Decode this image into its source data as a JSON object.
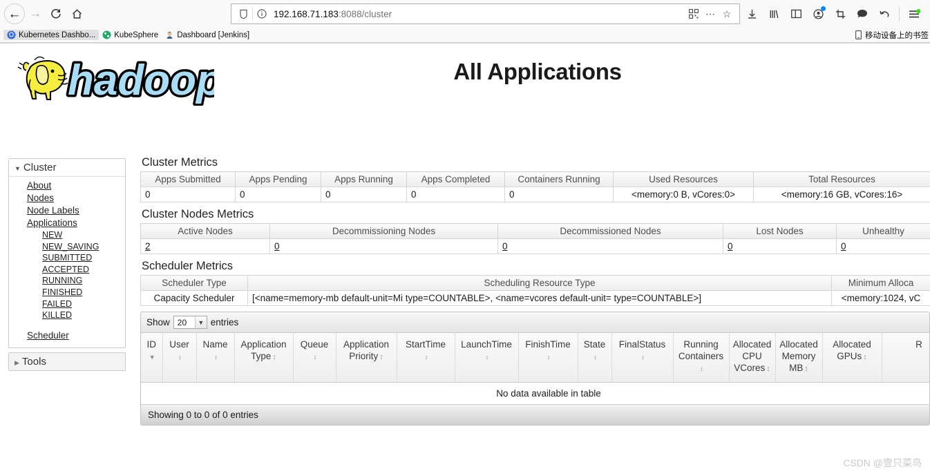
{
  "browser": {
    "nav": {
      "back_icon": "arrow-left-icon",
      "forward_icon": "arrow-right-icon",
      "reload_icon": "reload-icon",
      "home_icon": "home-icon"
    },
    "urlbar": {
      "shield_icon": "shield-icon",
      "info_icon": "info-circle-icon",
      "url_host": "192.168.71.183",
      "url_port_path": ":8088/cluster",
      "qr_icon": "qr-code-icon",
      "more_icon": "ellipsis-icon",
      "bookmark_icon": "star-icon"
    },
    "toolbar_icons": [
      "downloads-icon",
      "library-icon",
      "sidebar-icon",
      "account-icon",
      "screenshot-icon",
      "chat-icon",
      "undo-icon",
      "menu-icon"
    ],
    "bookmarks": [
      {
        "label": "Kubernetes Dashbo...",
        "icon": "kubernetes-icon"
      },
      {
        "label": "KubeSphere",
        "icon": "kubesphere-icon"
      },
      {
        "label": "Dashboard [Jenkins]",
        "icon": "jenkins-icon"
      }
    ],
    "mobile_bookmarks": {
      "label": "移动设备上的书签",
      "icon": "mobile-device-icon"
    }
  },
  "page": {
    "logo_alt": "hadoop",
    "title": "All Applications",
    "watermark": "CSDN @壹只菜鸟"
  },
  "sidebar": {
    "cluster": {
      "label": "Cluster",
      "links": [
        "About",
        "Nodes",
        "Node Labels",
        "Applications"
      ],
      "app_states": [
        "NEW",
        "NEW_SAVING",
        "SUBMITTED",
        "ACCEPTED",
        "RUNNING",
        "FINISHED",
        "FAILED",
        "KILLED"
      ],
      "scheduler": "Scheduler"
    },
    "tools": {
      "label": "Tools"
    }
  },
  "cluster_metrics": {
    "title": "Cluster Metrics",
    "headers": [
      "Apps Submitted",
      "Apps Pending",
      "Apps Running",
      "Apps Completed",
      "Containers Running",
      "Used Resources",
      "Total Resources"
    ],
    "values": [
      "0",
      "0",
      "0",
      "0",
      "0",
      "<memory:0 B, vCores:0>",
      "<memory:16 GB, vCores:16>"
    ]
  },
  "cluster_nodes_metrics": {
    "title": "Cluster Nodes Metrics",
    "headers": [
      "Active Nodes",
      "Decommissioning Nodes",
      "Decommissioned Nodes",
      "Lost Nodes",
      "Unhealthy"
    ],
    "values": [
      "2",
      "0",
      "0",
      "0",
      "0"
    ]
  },
  "scheduler_metrics": {
    "title": "Scheduler Metrics",
    "headers": [
      "Scheduler Type",
      "Scheduling Resource Type",
      "Minimum Alloca"
    ],
    "values": [
      "Capacity Scheduler",
      "[<name=memory-mb default-unit=Mi type=COUNTABLE>, <name=vcores default-unit= type=COUNTABLE>]",
      "<memory:1024, vC"
    ]
  },
  "apps_table": {
    "show_label": "Show",
    "entries_label": "entries",
    "page_size": "20",
    "columns": [
      {
        "label": "ID",
        "sort": "desc"
      },
      {
        "label": "User",
        "sort": "both"
      },
      {
        "label": "Name",
        "sort": "both"
      },
      {
        "label": "Application Type",
        "sort": "both"
      },
      {
        "label": "Queue",
        "sort": "both"
      },
      {
        "label": "Application Priority",
        "sort": "both"
      },
      {
        "label": "StartTime",
        "sort": "both"
      },
      {
        "label": "LaunchTime",
        "sort": "both"
      },
      {
        "label": "FinishTime",
        "sort": "both"
      },
      {
        "label": "State",
        "sort": "both"
      },
      {
        "label": "FinalStatus",
        "sort": "both"
      },
      {
        "label": "Running Containers",
        "sort": "both"
      },
      {
        "label": "Allocated CPU VCores",
        "sort": "both"
      },
      {
        "label": "Allocated Memory MB",
        "sort": "both"
      },
      {
        "label": "Allocated GPUs",
        "sort": "both"
      },
      {
        "label": "R",
        "sort": "none"
      }
    ],
    "empty_message": "No data available in table",
    "footer": "Showing 0 to 0 of 0 entries"
  }
}
